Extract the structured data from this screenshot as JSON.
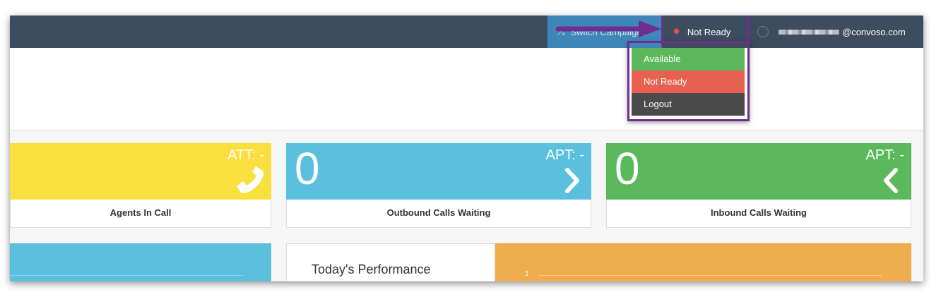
{
  "navbar": {
    "switch_campaigns_label": "Switch Campaigns",
    "status_label": "Not Ready",
    "user_email_suffix": "@convoso.com"
  },
  "status_menu": {
    "items": [
      {
        "label": "Available",
        "color": "#5cb85c"
      },
      {
        "label": "Not Ready",
        "color": "#e8604f"
      },
      {
        "label": "Logout",
        "color": "#4a4a4a"
      }
    ]
  },
  "stats": [
    {
      "code": "ATT: -",
      "value": "",
      "label": "Agents In Call",
      "icon": "phone-icon",
      "color": "#f9e03e"
    },
    {
      "code": "APT: -",
      "value": "0",
      "label": "Outbound Calls Waiting",
      "icon": "chevron-right-icon",
      "color": "#5bc0de"
    },
    {
      "code": "APT: -",
      "value": "0",
      "label": "Inbound Calls Waiting",
      "icon": "chevron-left-icon",
      "color": "#5cb85c"
    }
  ],
  "performance": {
    "title": "Today's Performance",
    "chart_tick": "1"
  },
  "colors": {
    "navbar": "#3e4c60",
    "highlight": "#6f2f8f",
    "switch_button": "#3f87b9",
    "performance_panel": "#f0ad4e"
  }
}
